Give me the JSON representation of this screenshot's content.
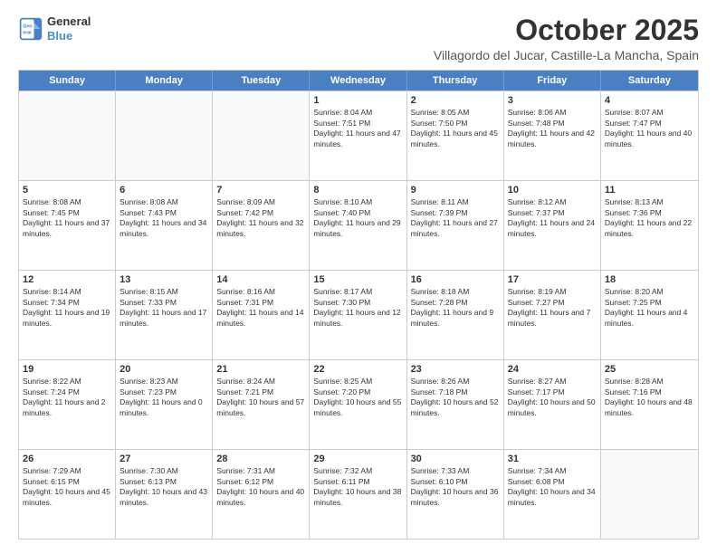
{
  "logo": {
    "line1": "General",
    "line2": "Blue"
  },
  "title": "October 2025",
  "subtitle": "Villagordo del Jucar, Castille-La Mancha, Spain",
  "header_days": [
    "Sunday",
    "Monday",
    "Tuesday",
    "Wednesday",
    "Thursday",
    "Friday",
    "Saturday"
  ],
  "rows": [
    [
      {
        "day": "",
        "text": "",
        "empty": true
      },
      {
        "day": "",
        "text": "",
        "empty": true
      },
      {
        "day": "",
        "text": "",
        "empty": true
      },
      {
        "day": "1",
        "text": "Sunrise: 8:04 AM\nSunset: 7:51 PM\nDaylight: 11 hours and 47 minutes.",
        "empty": false
      },
      {
        "day": "2",
        "text": "Sunrise: 8:05 AM\nSunset: 7:50 PM\nDaylight: 11 hours and 45 minutes.",
        "empty": false
      },
      {
        "day": "3",
        "text": "Sunrise: 8:06 AM\nSunset: 7:48 PM\nDaylight: 11 hours and 42 minutes.",
        "empty": false
      },
      {
        "day": "4",
        "text": "Sunrise: 8:07 AM\nSunset: 7:47 PM\nDaylight: 11 hours and 40 minutes.",
        "empty": false
      }
    ],
    [
      {
        "day": "5",
        "text": "Sunrise: 8:08 AM\nSunset: 7:45 PM\nDaylight: 11 hours and 37 minutes.",
        "empty": false
      },
      {
        "day": "6",
        "text": "Sunrise: 8:08 AM\nSunset: 7:43 PM\nDaylight: 11 hours and 34 minutes.",
        "empty": false
      },
      {
        "day": "7",
        "text": "Sunrise: 8:09 AM\nSunset: 7:42 PM\nDaylight: 11 hours and 32 minutes.",
        "empty": false
      },
      {
        "day": "8",
        "text": "Sunrise: 8:10 AM\nSunset: 7:40 PM\nDaylight: 11 hours and 29 minutes.",
        "empty": false
      },
      {
        "day": "9",
        "text": "Sunrise: 8:11 AM\nSunset: 7:39 PM\nDaylight: 11 hours and 27 minutes.",
        "empty": false
      },
      {
        "day": "10",
        "text": "Sunrise: 8:12 AM\nSunset: 7:37 PM\nDaylight: 11 hours and 24 minutes.",
        "empty": false
      },
      {
        "day": "11",
        "text": "Sunrise: 8:13 AM\nSunset: 7:36 PM\nDaylight: 11 hours and 22 minutes.",
        "empty": false
      }
    ],
    [
      {
        "day": "12",
        "text": "Sunrise: 8:14 AM\nSunset: 7:34 PM\nDaylight: 11 hours and 19 minutes.",
        "empty": false
      },
      {
        "day": "13",
        "text": "Sunrise: 8:15 AM\nSunset: 7:33 PM\nDaylight: 11 hours and 17 minutes.",
        "empty": false
      },
      {
        "day": "14",
        "text": "Sunrise: 8:16 AM\nSunset: 7:31 PM\nDaylight: 11 hours and 14 minutes.",
        "empty": false
      },
      {
        "day": "15",
        "text": "Sunrise: 8:17 AM\nSunset: 7:30 PM\nDaylight: 11 hours and 12 minutes.",
        "empty": false
      },
      {
        "day": "16",
        "text": "Sunrise: 8:18 AM\nSunset: 7:28 PM\nDaylight: 11 hours and 9 minutes.",
        "empty": false
      },
      {
        "day": "17",
        "text": "Sunrise: 8:19 AM\nSunset: 7:27 PM\nDaylight: 11 hours and 7 minutes.",
        "empty": false
      },
      {
        "day": "18",
        "text": "Sunrise: 8:20 AM\nSunset: 7:25 PM\nDaylight: 11 hours and 4 minutes.",
        "empty": false
      }
    ],
    [
      {
        "day": "19",
        "text": "Sunrise: 8:22 AM\nSunset: 7:24 PM\nDaylight: 11 hours and 2 minutes.",
        "empty": false
      },
      {
        "day": "20",
        "text": "Sunrise: 8:23 AM\nSunset: 7:23 PM\nDaylight: 11 hours and 0 minutes.",
        "empty": false
      },
      {
        "day": "21",
        "text": "Sunrise: 8:24 AM\nSunset: 7:21 PM\nDaylight: 10 hours and 57 minutes.",
        "empty": false
      },
      {
        "day": "22",
        "text": "Sunrise: 8:25 AM\nSunset: 7:20 PM\nDaylight: 10 hours and 55 minutes.",
        "empty": false
      },
      {
        "day": "23",
        "text": "Sunrise: 8:26 AM\nSunset: 7:18 PM\nDaylight: 10 hours and 52 minutes.",
        "empty": false
      },
      {
        "day": "24",
        "text": "Sunrise: 8:27 AM\nSunset: 7:17 PM\nDaylight: 10 hours and 50 minutes.",
        "empty": false
      },
      {
        "day": "25",
        "text": "Sunrise: 8:28 AM\nSunset: 7:16 PM\nDaylight: 10 hours and 48 minutes.",
        "empty": false
      }
    ],
    [
      {
        "day": "26",
        "text": "Sunrise: 7:29 AM\nSunset: 6:15 PM\nDaylight: 10 hours and 45 minutes.",
        "empty": false
      },
      {
        "day": "27",
        "text": "Sunrise: 7:30 AM\nSunset: 6:13 PM\nDaylight: 10 hours and 43 minutes.",
        "empty": false
      },
      {
        "day": "28",
        "text": "Sunrise: 7:31 AM\nSunset: 6:12 PM\nDaylight: 10 hours and 40 minutes.",
        "empty": false
      },
      {
        "day": "29",
        "text": "Sunrise: 7:32 AM\nSunset: 6:11 PM\nDaylight: 10 hours and 38 minutes.",
        "empty": false
      },
      {
        "day": "30",
        "text": "Sunrise: 7:33 AM\nSunset: 6:10 PM\nDaylight: 10 hours and 36 minutes.",
        "empty": false
      },
      {
        "day": "31",
        "text": "Sunrise: 7:34 AM\nSunset: 6:08 PM\nDaylight: 10 hours and 34 minutes.",
        "empty": false
      },
      {
        "day": "",
        "text": "",
        "empty": true
      }
    ]
  ]
}
